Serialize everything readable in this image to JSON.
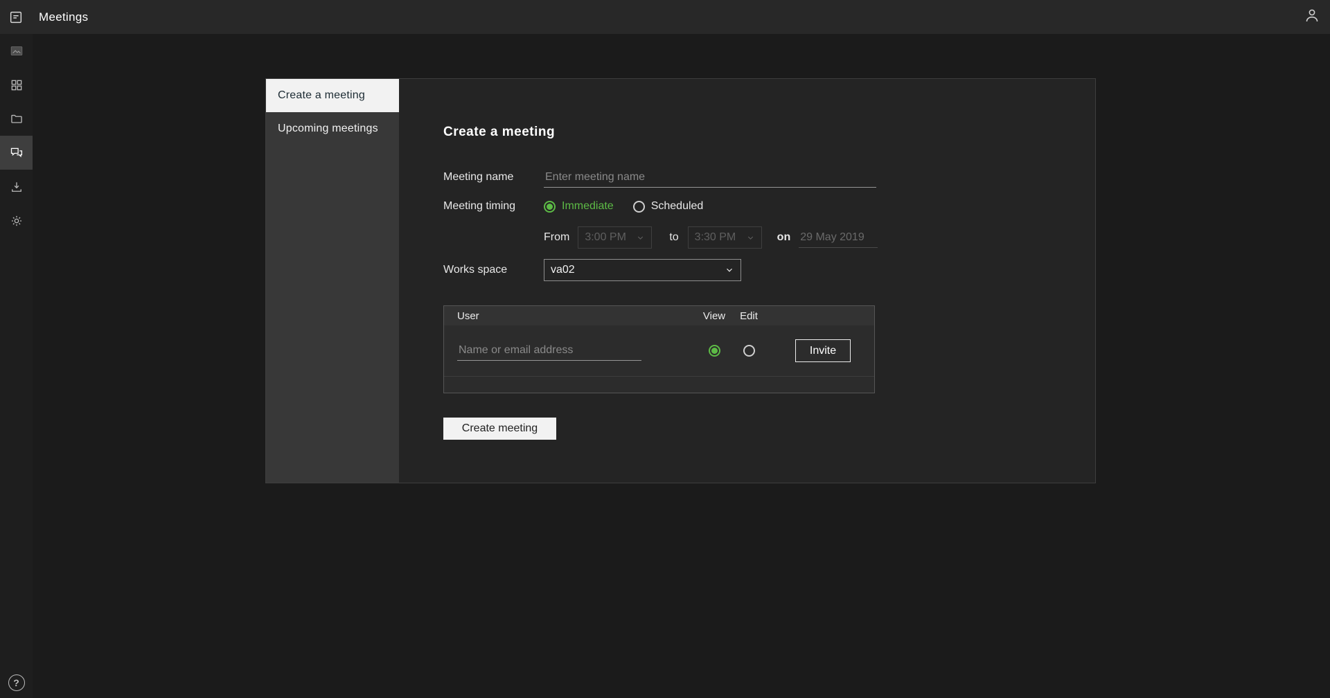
{
  "topbar": {
    "title": "Meetings"
  },
  "sidebar": {
    "items": [
      {
        "icon": "thumbnail-icon",
        "active": false
      },
      {
        "icon": "apps-grid-icon",
        "active": false
      },
      {
        "icon": "folder-icon",
        "active": false
      },
      {
        "icon": "meetings-chat-icon",
        "active": true
      },
      {
        "icon": "download-icon",
        "active": false
      },
      {
        "icon": "settings-gear-icon",
        "active": false
      }
    ],
    "help_glyph": "?"
  },
  "subnav": {
    "items": [
      {
        "label": "Create a meeting",
        "active": true
      },
      {
        "label": "Upcoming meetings",
        "active": false
      }
    ]
  },
  "form": {
    "heading": "Create a meeting",
    "meeting_name": {
      "label": "Meeting name",
      "placeholder": "Enter meeting name",
      "value": ""
    },
    "meeting_timing": {
      "label": "Meeting timing",
      "immediate": "Immediate",
      "scheduled": "Scheduled",
      "selected": "Immediate"
    },
    "schedule": {
      "from_label": "From",
      "from_time": "3:00 PM",
      "to_label": "to",
      "to_time": "3:30 PM",
      "on_label": "on",
      "date": "29 May 2019",
      "enabled": false
    },
    "workspace": {
      "label": "Works space",
      "selected": "va02"
    },
    "invite": {
      "headers": {
        "user": "User",
        "view": "View",
        "edit": "Edit"
      },
      "row": {
        "user_placeholder": "Name or email address",
        "view_selected": true,
        "edit_selected": false,
        "invite_button": "Invite"
      }
    },
    "create_button": "Create meeting"
  },
  "colors": {
    "accent_green": "#5dbb46",
    "topbar_bg": "#282828",
    "panel_bg": "#242424",
    "subnav_bg": "#383838",
    "active_tab_bg": "#f2f2f2"
  }
}
